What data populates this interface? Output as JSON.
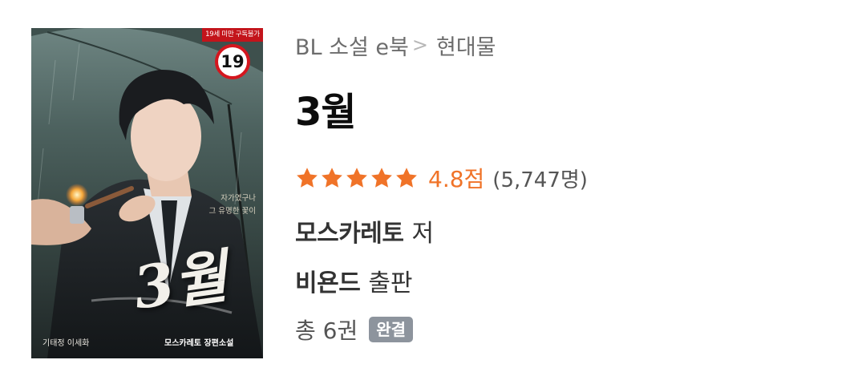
{
  "cover": {
    "age_banner": "19세 미만 구독불가",
    "age_badge": "19",
    "tagline_line1": "자가였구나",
    "tagline_line2": "그 유명한 꽃이",
    "title_art": "3월",
    "credit_left": "기태정 이세화",
    "credit_right": "모스카레토 장편소설"
  },
  "breadcrumb": {
    "category": "BL 소설 e북",
    "separator": ">",
    "genre": "현대물"
  },
  "title": "3월",
  "rating": {
    "stars": 5,
    "star_color": "#f07328",
    "score": "4.8점",
    "count": "(5,747명)"
  },
  "author": {
    "name": "모스카레토",
    "suffix": "저"
  },
  "publisher": {
    "name": "비욘드",
    "suffix": "출판"
  },
  "volumes": {
    "text": "총 6권",
    "badge": "완결",
    "badge_color": "#8d949d"
  }
}
